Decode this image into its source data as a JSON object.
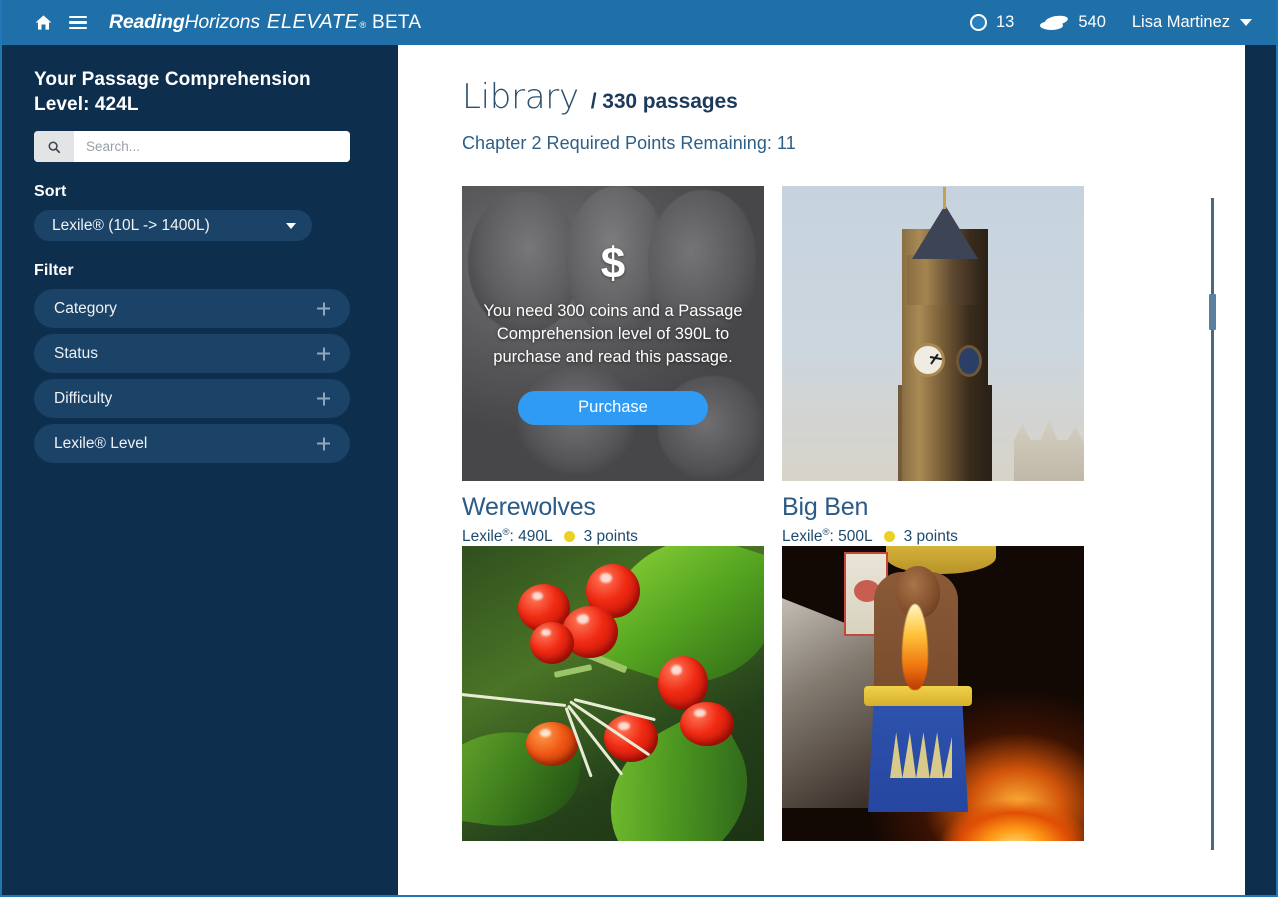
{
  "header": {
    "home_icon": "home-icon",
    "menu_icon": "hamburger-menu-icon",
    "brand_bold": "Reading",
    "brand_light": "Horizons",
    "brand_product": "ELEVATE",
    "brand_registered": "®",
    "brand_beta": "BETA",
    "points_icon": "ring-points-icon",
    "points_value": "13",
    "coins_icon": "stacked-coins-icon",
    "coins_value": "540",
    "user_name": "Lisa Martinez",
    "user_caret_icon": "chevron-down-icon",
    "bar_color": "#1f6fa9"
  },
  "sidebar": {
    "level_heading": "Your Passage Comprehension Level: 424L",
    "search": {
      "icon": "search-icon",
      "placeholder": "Search...",
      "value": ""
    },
    "sort_label": "Sort",
    "sort_selected": "Lexile® (10L -> 1400L)",
    "sort_caret_icon": "chevron-down-icon",
    "filter_label": "Filter",
    "filters": [
      {
        "label": "Category",
        "icon": "plus-icon"
      },
      {
        "label": "Status",
        "icon": "plus-icon"
      },
      {
        "label": "Difficulty",
        "icon": "plus-icon"
      },
      {
        "label": "Lexile® Level",
        "icon": "plus-icon"
      }
    ],
    "bg_color": "#0e2e4d",
    "pill_color": "#1b4368"
  },
  "main": {
    "page_title": "Library",
    "passage_count": "/ 330 passages",
    "chapter_note": "Chapter 2 Required Points Remaining: 11",
    "cards": [
      {
        "title": "Werewolves",
        "lexile_label": "Lexile",
        "lexile_reg": "®",
        "lexile_value": ": 490L",
        "points": "3 points",
        "point_dot_color": "#e8d225",
        "image": "werewolves-illustration",
        "locked": true,
        "locked_dollar": "$",
        "locked_message": "You need 300 coins and a Passage Comprehension level of 390L to purchase and read this passage.",
        "purchase_label": "Purchase",
        "purchase_color": "#2f9bf5"
      },
      {
        "title": "Big Ben",
        "lexile_label": "Lexile",
        "lexile_reg": "®",
        "lexile_value": ": 500L",
        "points": "3 points",
        "point_dot_color": "#e8d225",
        "image": "big-ben-clock-tower-photo",
        "locked": false
      },
      {
        "title": "",
        "image": "red-berries-photo",
        "locked": false
      },
      {
        "title": "",
        "image": "fire-dancer-performer-photo",
        "locked": false
      }
    ]
  },
  "scrollbar": {
    "name": "content-vertical-scrollbar"
  }
}
